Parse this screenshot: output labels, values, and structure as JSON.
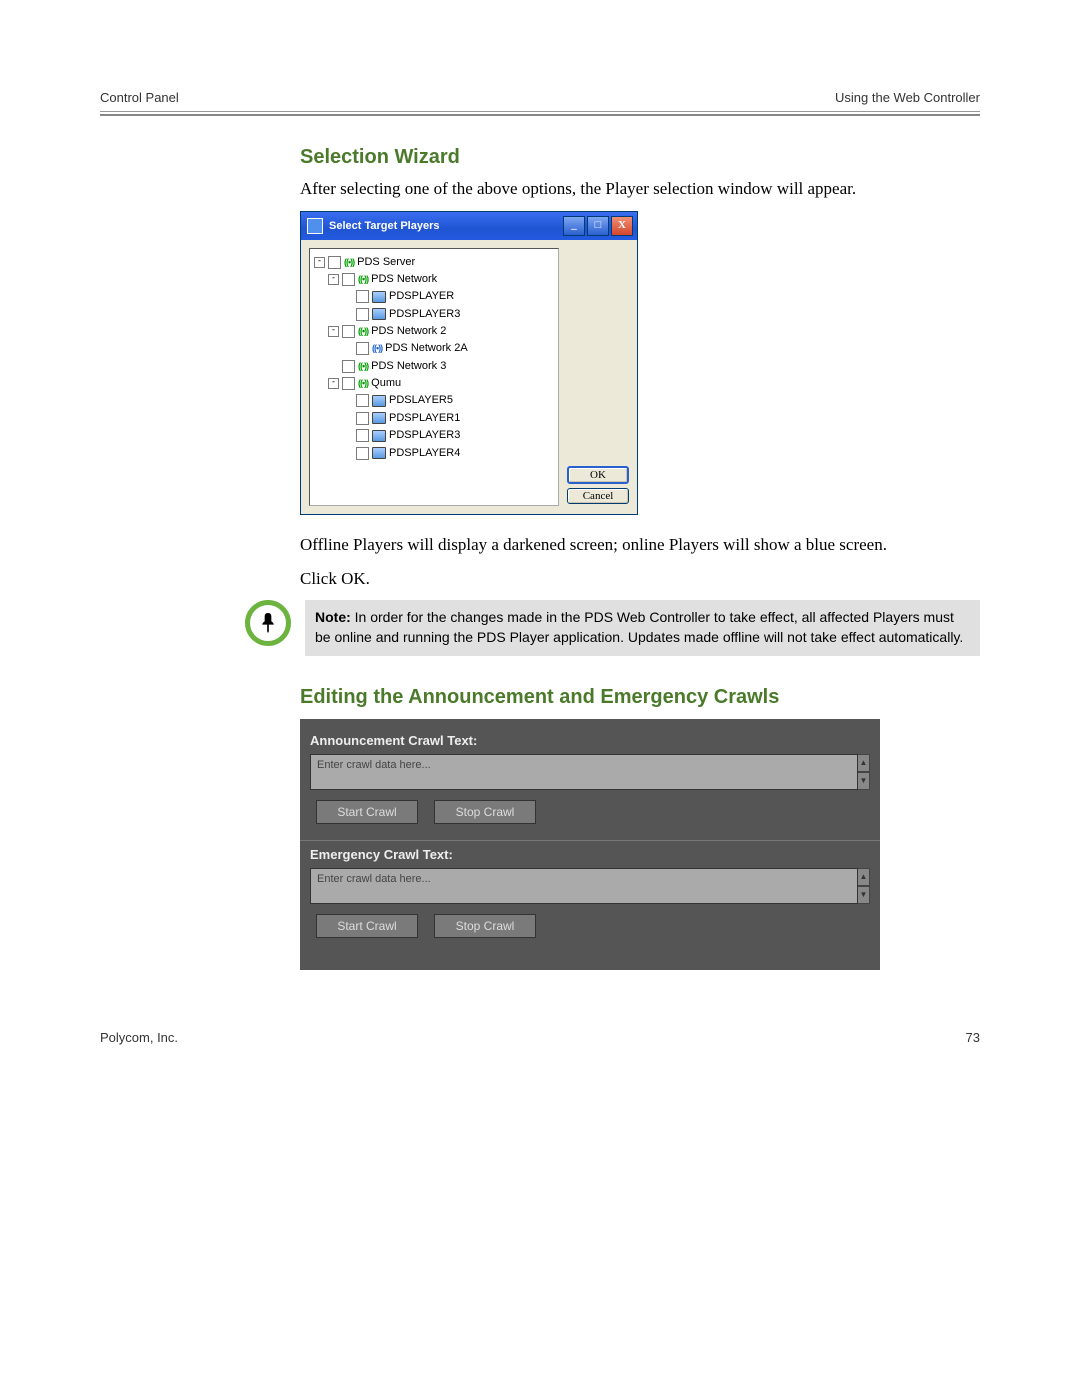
{
  "header": {
    "left": "Control Panel",
    "right": "Using the Web Controller"
  },
  "sections": {
    "wizard_title": "Selection Wizard",
    "wizard_intro": "After selecting one of the above options, the Player selection window will appear.",
    "after_tree1": "Offline Players will display a darkened screen; online Players will show a blue screen.",
    "after_tree2": "Click OK.",
    "crawls_title": "Editing the Announcement and Emergency Crawls"
  },
  "dialog": {
    "title": "Select Target Players",
    "ok": "OK",
    "cancel": "Cancel",
    "tree": {
      "root": "PDS Server",
      "n1": "PDS Network",
      "n1a": "PDSPLAYER",
      "n1b": "PDSPLAYER3",
      "n2": "PDS Network 2",
      "n2a": "PDS Network 2A",
      "n3": "PDS Network 3",
      "n4": "Qumu",
      "n4a": "PDSLAYER5",
      "n4b": "PDSPLAYER1",
      "n4c": "PDSPLAYER3",
      "n4d": "PDSPLAYER4"
    }
  },
  "note": {
    "label": "Note:",
    "text": "In order for the changes made in the PDS Web Controller to take effect, all affected Players must be online and running the PDS Player application. Updates made offline will not take effect automatically."
  },
  "crawl": {
    "ann_label": "Announcement Crawl Text:",
    "emg_label": "Emergency Crawl Text:",
    "placeholder": "Enter crawl data here...",
    "start": "Start Crawl",
    "stop": "Stop Crawl"
  },
  "footer": {
    "left": "Polycom, Inc.",
    "right": "73"
  }
}
